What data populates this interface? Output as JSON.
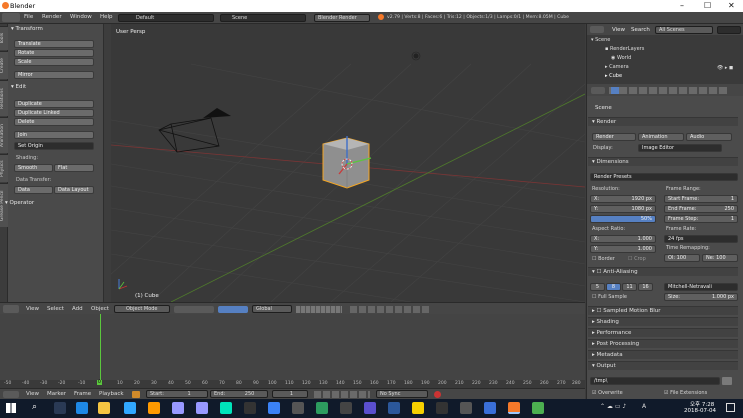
{
  "window": {
    "title": "Blender",
    "controls": [
      "–",
      "☐",
      "✕"
    ]
  },
  "menubar": {
    "items": [
      "File",
      "Render",
      "Window",
      "Help"
    ],
    "layout": "Default",
    "scene": "Scene",
    "engine": "Blender Render",
    "stats": "v2.79 | Verts:8 | Faces:6 | Tris:12 | Objects:1/3 | Lamps:0/1 | Mem:8.05M | Cube"
  },
  "tool_tabs": [
    "Tools",
    "Create",
    "Relations",
    "Animation",
    "Physics",
    "Grease Pencil"
  ],
  "toolshelf": {
    "transform_header": "Transform",
    "translate": "Translate",
    "rotate": "Rotate",
    "scale": "Scale",
    "mirror": "Mirror",
    "edit_header": "Edit",
    "duplicate": "Duplicate",
    "duplicate_linked": "Duplicate Linked",
    "delete": "Delete",
    "join": "Join",
    "set_origin": "Set Origin",
    "shading_label": "Shading:",
    "smooth": "Smooth",
    "flat": "Flat",
    "data_transfer_label": "Data Transfer:",
    "data": "Data",
    "data_layout": "Data Layout",
    "operator_header": "Operator"
  },
  "viewport": {
    "view_label": "User Persp",
    "object_label": "(1) Cube"
  },
  "view_toolbar": {
    "items": [
      "View",
      "Select",
      "Add",
      "Object"
    ],
    "mode": "Object Mode",
    "orientation": "Global"
  },
  "timeline": {
    "ticks": [
      "-50",
      "-40",
      "-30",
      "-20",
      "-10",
      "0",
      "10",
      "20",
      "30",
      "40",
      "50",
      "60",
      "70",
      "80",
      "90",
      "100",
      "110",
      "120",
      "130",
      "140",
      "150",
      "160",
      "170",
      "180",
      "190",
      "200",
      "210",
      "220",
      "230",
      "240",
      "250",
      "260",
      "270",
      "280"
    ],
    "current_frame_tick": "0"
  },
  "timeline_toolbar": {
    "items": [
      "View",
      "Marker",
      "Frame",
      "Playback"
    ],
    "start_label": "Start:",
    "start": "1",
    "end_label": "End:",
    "end": "250",
    "current": "1",
    "sync": "No Sync"
  },
  "outliner": {
    "view": "View",
    "search": "Search",
    "scenes": "All Scenes",
    "items": [
      "Scene",
      "RenderLayers",
      "World",
      "Camera",
      "Cube"
    ]
  },
  "properties": {
    "breadcrumb": "Scene",
    "render_header": "Render",
    "render_btn": "Render",
    "animation_btn": "Animation",
    "audio_btn": "Audio",
    "display_label": "Display:",
    "display_value": "Image Editor",
    "dimensions_header": "Dimensions",
    "render_presets": "Render Presets",
    "resolution_label": "Resolution:",
    "res_x_label": "X:",
    "res_x": "1920 px",
    "res_y_label": "Y:",
    "res_y": "1080 px",
    "res_pct": "50%",
    "frame_range_label": "Frame Range:",
    "start_frame_label": "Start Frame:",
    "start_frame": "1",
    "end_frame_label": "End Frame:",
    "end_frame": "250",
    "frame_step_label": "Frame Step:",
    "frame_step": "1",
    "aspect_label": "Aspect Ratio:",
    "asp_x_label": "X:",
    "asp_x": "1.000",
    "asp_y_label": "Y:",
    "asp_y": "1.000",
    "frame_rate_label": "Frame Rate:",
    "frame_rate": "24 fps",
    "time_remap_label": "Time Remapping:",
    "old": "Ol: 100",
    "new": "Ne: 100",
    "border": "Border",
    "crop": "Crop",
    "aa_header": "Anti-Aliasing",
    "aa_samples": [
      "5",
      "8",
      "11",
      "16"
    ],
    "aa_filter": "Mitchell-Netravali",
    "full_sample": "Full Sample",
    "size_label": "Size:",
    "size": "1.000 px",
    "collapsed": [
      "Sampled Motion Blur",
      "Shading",
      "Performance",
      "Post Processing",
      "Metadata",
      "Output"
    ],
    "output_path": "/tmp\\",
    "overwrite": "Overwrite",
    "file_extensions": "File Extensions"
  },
  "taskbar": {
    "time": "오후 7:28",
    "date": "2018-07-04",
    "lang": "A"
  },
  "colors": {
    "accent": "#5680c2",
    "selection": "#f5a623",
    "bg": "#393939"
  }
}
